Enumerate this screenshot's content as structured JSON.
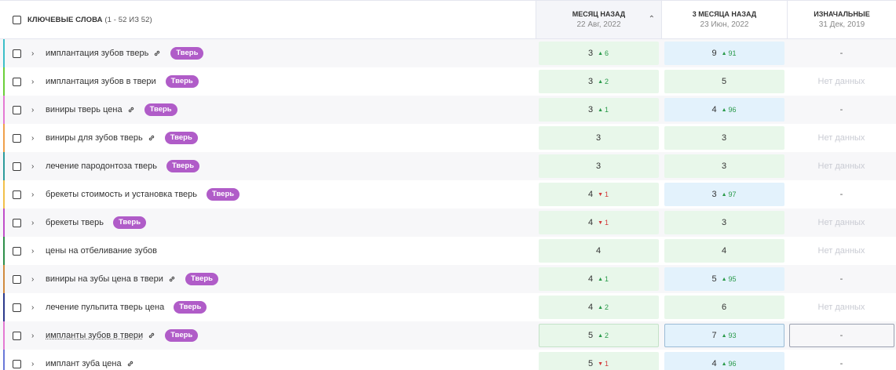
{
  "header": {
    "keywords_label": "КЛЮЧЕВЫЕ СЛОВА",
    "keywords_count": "(1 - 52 ИЗ 52)",
    "columns": [
      {
        "title": "МЕСЯЦ НАЗАД",
        "date": "22 Авг, 2022",
        "sorted": true,
        "sort_icon": "caret-up-icon"
      },
      {
        "title": "3 МЕСЯЦА НАЗАД",
        "date": "23 Июн, 2022"
      },
      {
        "title": "ИЗНАЧАЛЬНЫЕ",
        "date": "31 Дек, 2019"
      }
    ]
  },
  "rows": [
    {
      "keyword": "имплантация зубов тверь",
      "link": true,
      "tag": "Тверь",
      "accent": "#3dbfc8",
      "m1": {
        "value": "3",
        "delta": "6",
        "dir": "up"
      },
      "m3": {
        "value": "9",
        "delta": "91",
        "dir": "up"
      },
      "initial": "-"
    },
    {
      "keyword": "имплантация зубов в твери",
      "link": false,
      "tag": "Тверь",
      "accent": "#6bcf3a",
      "m1": {
        "value": "3",
        "delta": "2",
        "dir": "up"
      },
      "m3": {
        "value": "5"
      },
      "initial": "Нет данных"
    },
    {
      "keyword": "виниры тверь цена",
      "link": true,
      "tag": "Тверь",
      "accent": "#e47ad3",
      "m1": {
        "value": "3",
        "delta": "1",
        "dir": "up"
      },
      "m3": {
        "value": "4",
        "delta": "96",
        "dir": "up"
      },
      "initial": "-"
    },
    {
      "keyword": "виниры для зубов тверь",
      "link": true,
      "tag": "Тверь",
      "accent": "#f0a04b",
      "m1": {
        "value": "3"
      },
      "m3": {
        "value": "3"
      },
      "initial": "Нет данных"
    },
    {
      "keyword": "лечение пародонтоза тверь",
      "link": false,
      "tag": "Тверь",
      "accent": "#2e9b9b",
      "m1": {
        "value": "3"
      },
      "m3": {
        "value": "3"
      },
      "initial": "Нет данных"
    },
    {
      "keyword": "брекеты стоимость и установка тверь",
      "link": false,
      "tag": "Тверь",
      "accent": "#f2c04a",
      "m1": {
        "value": "4",
        "delta": "1",
        "dir": "down"
      },
      "m3": {
        "value": "3",
        "delta": "97",
        "dir": "up"
      },
      "initial": "-"
    },
    {
      "keyword": "брекеты тверь",
      "link": false,
      "tag": "Тверь",
      "accent": "#c04fc9",
      "m1": {
        "value": "4",
        "delta": "1",
        "dir": "down"
      },
      "m3": {
        "value": "3"
      },
      "initial": "Нет данных"
    },
    {
      "keyword": "цены на отбеливание зубов",
      "link": false,
      "tag": "",
      "accent": "#2f8f4a",
      "m1": {
        "value": "4"
      },
      "m3": {
        "value": "4"
      },
      "initial": "Нет данных"
    },
    {
      "keyword": "виниры на зубы цена в твери",
      "link": true,
      "tag": "Тверь",
      "accent": "#d08b3e",
      "m1": {
        "value": "4",
        "delta": "1",
        "dir": "up"
      },
      "m3": {
        "value": "5",
        "delta": "95",
        "dir": "up"
      },
      "initial": "-"
    },
    {
      "keyword": "лечение пульпита тверь цена",
      "link": false,
      "tag": "Тверь",
      "accent": "#2d3a8c",
      "m1": {
        "value": "4",
        "delta": "2",
        "dir": "up"
      },
      "m3": {
        "value": "6"
      },
      "initial": "Нет данных"
    },
    {
      "keyword": "импланты зубов в твери",
      "link": true,
      "tag": "Тверь",
      "accent": "#e47ad3",
      "hovered": true,
      "m1": {
        "value": "5",
        "delta": "2",
        "dir": "up"
      },
      "m3": {
        "value": "7",
        "delta": "93",
        "dir": "up"
      },
      "initial": "-"
    },
    {
      "keyword": "имплант зуба цена",
      "link": true,
      "tag": "",
      "accent": "#6a78d8",
      "m1": {
        "value": "5",
        "delta": "1",
        "dir": "down"
      },
      "m3": {
        "value": "4",
        "delta": "96",
        "dir": "up"
      },
      "initial": "-"
    }
  ]
}
